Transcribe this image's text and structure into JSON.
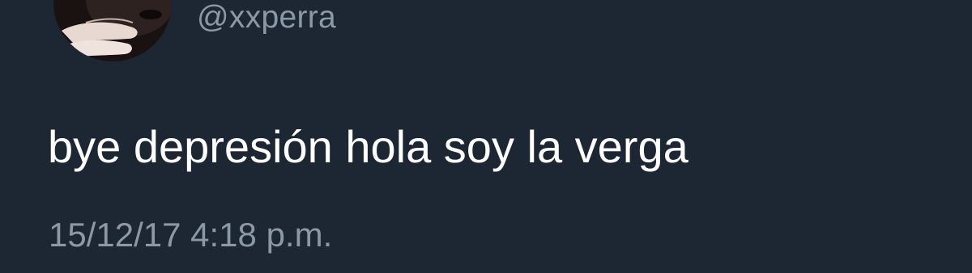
{
  "profile": {
    "handle": "@xxperra",
    "avatar_icon": "profile-photo"
  },
  "tweet": {
    "text": "bye depresión hola soy la verga",
    "timestamp": "15/12/17 4:18 p.m."
  },
  "colors": {
    "background": "#1c2733",
    "primary_text": "#ffffff",
    "secondary_text": "#8b98a5"
  }
}
